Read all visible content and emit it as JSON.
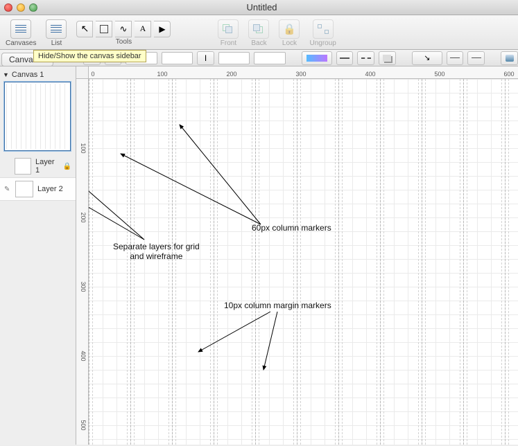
{
  "window": {
    "title": "Untitled"
  },
  "toolbar": {
    "canvases": "Canvases",
    "list": "List",
    "tools": "Tools",
    "front": "Front",
    "back": "Back",
    "lock": "Lock",
    "ungroup": "Ungroup",
    "tooltip": "Hide/Show the canvas sidebar"
  },
  "sidebar": {
    "header": "Canvases",
    "canvas": {
      "name": "Canvas 1"
    },
    "layers": [
      {
        "name": "Layer 1",
        "locked": true
      },
      {
        "name": "Layer 2",
        "editing": true
      }
    ]
  },
  "ruler": {
    "h": [
      "0",
      "100",
      "200",
      "300",
      "400",
      "500",
      "600"
    ],
    "v": [
      "100",
      "200",
      "300",
      "400",
      "500"
    ]
  },
  "annotations": {
    "layers_text1": "Separate layers for grid",
    "layers_text2": "and wireframe",
    "col60": "60px column markers",
    "margin10": "10px column margin markers"
  }
}
